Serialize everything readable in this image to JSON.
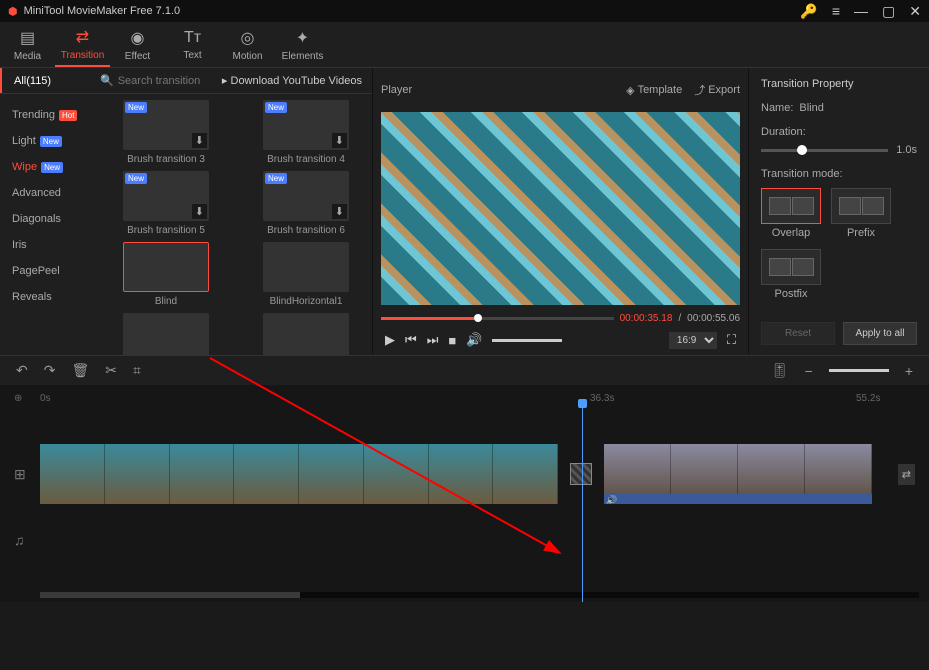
{
  "app": {
    "title": "MiniTool MovieMaker Free 7.1.0"
  },
  "toolbar": {
    "tabs": [
      {
        "label": "Media",
        "icon": "▤"
      },
      {
        "label": "Transition",
        "icon": "⇄"
      },
      {
        "label": "Effect",
        "icon": "◉"
      },
      {
        "label": "Text",
        "icon": "Tᴛ"
      },
      {
        "label": "Motion",
        "icon": "◎"
      },
      {
        "label": "Elements",
        "icon": "✦"
      }
    ],
    "active": "Transition"
  },
  "left": {
    "all_label": "All(115)",
    "search_placeholder": "Search transition",
    "download_label": "Download YouTube Videos",
    "categories": [
      "Trending",
      "Light",
      "Wipe",
      "Advanced",
      "Diagonals",
      "Iris",
      "PagePeel",
      "Reveals"
    ],
    "active_category": "Wipe",
    "thumbs": [
      {
        "label": "Brush transition 3",
        "new": true,
        "dl": true
      },
      {
        "label": "Brush transition 4",
        "new": true,
        "dl": true
      },
      {
        "label": "Brush transition 5",
        "new": true,
        "dl": true
      },
      {
        "label": "Brush transition 6",
        "new": true,
        "dl": true
      },
      {
        "label": "Blind",
        "selected": true,
        "pattern": "hatch"
      },
      {
        "label": "BlindHorizontal1",
        "pattern": "hlines"
      },
      {
        "label": "",
        "pattern": "vlines"
      },
      {
        "label": "",
        "pattern": "dots"
      }
    ]
  },
  "player": {
    "title": "Player",
    "template_label": "Template",
    "export_label": "Export",
    "current_time": "00:00:35.18",
    "total_time": "00:00:55.06",
    "aspect": "16:9"
  },
  "props": {
    "header": "Transition Property",
    "name_label": "Name:",
    "name_value": "Blind",
    "duration_label": "Duration:",
    "duration_value": "1.0s",
    "mode_label": "Transition mode:",
    "modes": [
      "Overlap",
      "Prefix",
      "Postfix"
    ],
    "selected_mode": "Overlap",
    "reset_label": "Reset",
    "apply_label": "Apply to all"
  },
  "timeline": {
    "zero": "0s",
    "playhead_time": "36.3s",
    "marker_time": "55.2s"
  }
}
